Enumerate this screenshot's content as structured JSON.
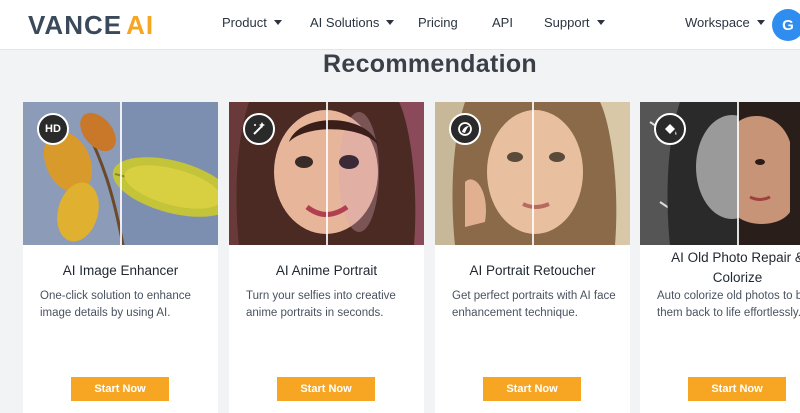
{
  "header": {
    "logo_main": "VANCE",
    "logo_accent": "AI",
    "nav": [
      {
        "label": "Product",
        "has_dropdown": true
      },
      {
        "label": "AI Solutions",
        "has_dropdown": true
      },
      {
        "label": "Pricing",
        "has_dropdown": false
      },
      {
        "label": "API",
        "has_dropdown": false
      },
      {
        "label": "Support",
        "has_dropdown": true
      },
      {
        "label": "Workspace",
        "has_dropdown": true
      }
    ],
    "avatar_letter": "G"
  },
  "section_title": "Recommendation",
  "cards": [
    {
      "badge": "HD",
      "badge_icon": "hd-icon",
      "title": "AI Image Enhancer",
      "description": "One-click solution to enhance image details by using AI.",
      "button": "Start Now"
    },
    {
      "badge": "",
      "badge_icon": "magic-wand-icon",
      "title": "AI Anime Portrait",
      "description": "Turn your selfies into creative anime portraits in seconds.",
      "button": "Start Now"
    },
    {
      "badge": "",
      "badge_icon": "portrait-retouch-icon",
      "title": "AI Portrait Retoucher",
      "description": "Get perfect portraits with AI face enhancement technique.",
      "button": "Start Now"
    },
    {
      "badge": "",
      "badge_icon": "paint-bucket-icon",
      "title": "AI Old Photo Repair & Colorize",
      "description": "Auto colorize old photos to bring them back to life effortlessly.",
      "button": "Start Now"
    }
  ],
  "colors": {
    "accent": "#f6a623",
    "avatar": "#2f8df0",
    "background": "#f2f3f5"
  }
}
